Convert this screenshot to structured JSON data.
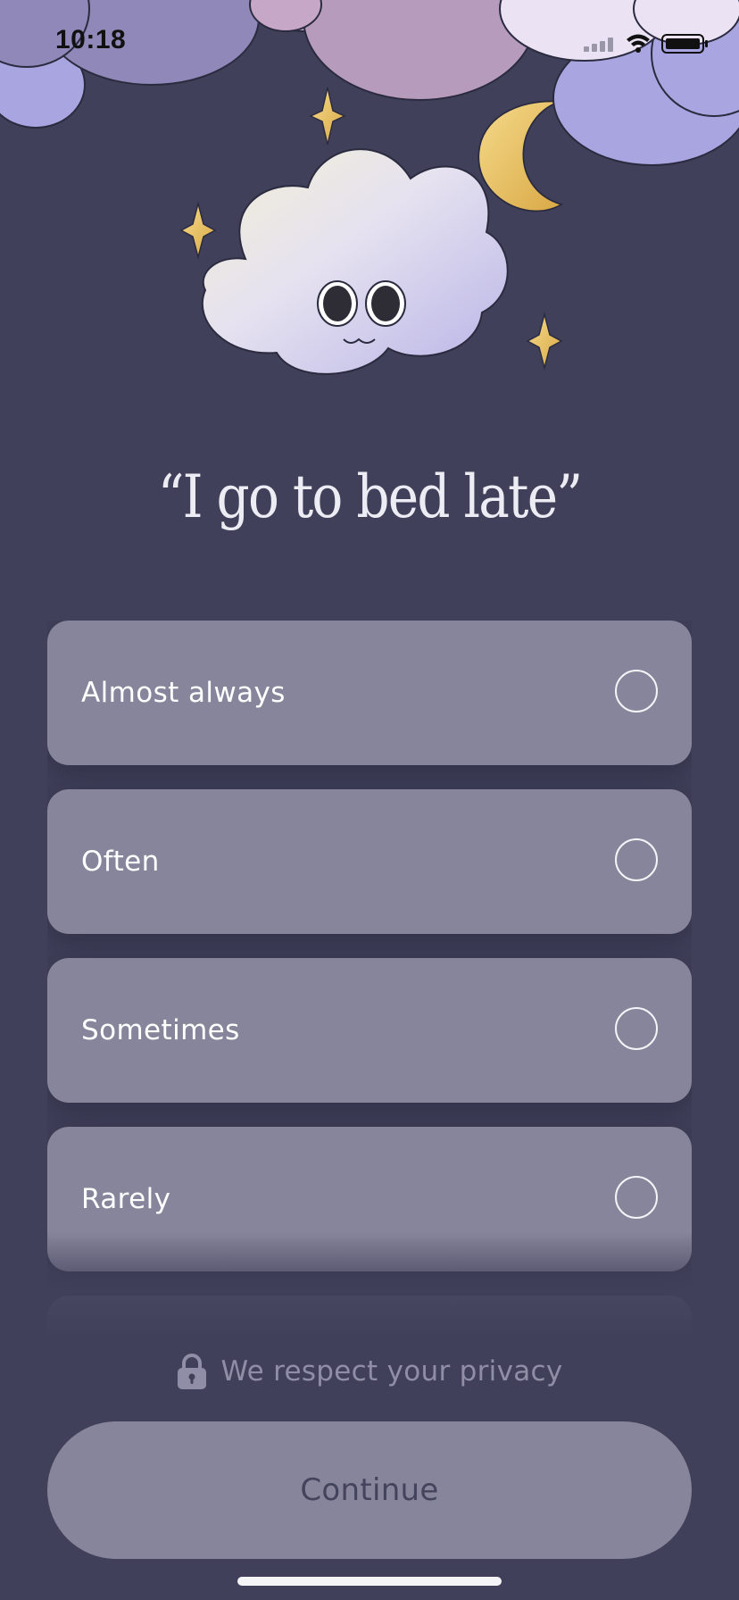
{
  "status_bar": {
    "time": "10:18",
    "icons": [
      "signal-icon",
      "wifi-icon",
      "battery-icon"
    ]
  },
  "question": {
    "title": "“I go to bed late”"
  },
  "options": [
    {
      "label": "Almost always",
      "selected": false
    },
    {
      "label": "Often",
      "selected": false
    },
    {
      "label": "Sometimes",
      "selected": false
    },
    {
      "label": "Rarely",
      "selected": false
    }
  ],
  "privacy": {
    "icon": "lock-icon",
    "text": "We respect your privacy"
  },
  "continue_button": {
    "label": "Continue"
  },
  "colors": {
    "background": "#40405a",
    "option_fill": "#86859b",
    "button_fill": "#86859b",
    "star_gold": "#e8c25e",
    "cloud_lavender": "#a9a5e0"
  }
}
